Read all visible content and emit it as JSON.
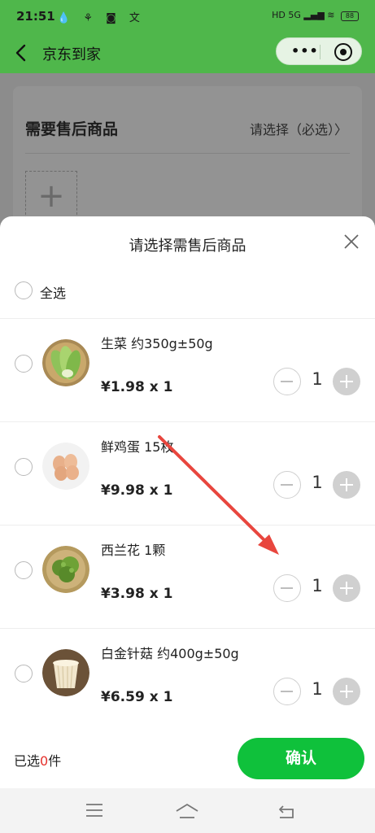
{
  "status": {
    "time": "21:51",
    "icons": "💧 ⚘ ◙ 文",
    "right": "HD 5G ▂▄▆ ≋",
    "battery": "88"
  },
  "header": {
    "title": "京东到家",
    "more_icon": "•••"
  },
  "background": {
    "section_title": "需要售后商品",
    "select_hint": "请选择（必选）",
    "chevron": "〉",
    "add_icon": "+"
  },
  "sheet": {
    "title": "请选择需售后商品",
    "select_all": "全选",
    "items": [
      {
        "name": "生菜 约350g±50g",
        "price": "¥1.98 x 1",
        "qty": "1",
        "thumb": "lettuce"
      },
      {
        "name": "鲜鸡蛋 15枚",
        "price": "¥9.98 x 1",
        "qty": "1",
        "thumb": "eggs"
      },
      {
        "name": "西兰花 1颗",
        "price": "¥3.98 x 1",
        "qty": "1",
        "thumb": "broccoli"
      },
      {
        "name": "白金针菇 约400g±50g",
        "price": "¥6.59 x 1",
        "qty": "1",
        "thumb": "enoki"
      }
    ]
  },
  "footer": {
    "selected_prefix": "已选",
    "selected_count": "0",
    "selected_suffix": "件",
    "confirm": "确认"
  },
  "colors": {
    "brand_green": "#4fb74b",
    "confirm_green": "#0fc13b",
    "count_red": "#e5322d",
    "arrow_red": "#e8463e"
  }
}
